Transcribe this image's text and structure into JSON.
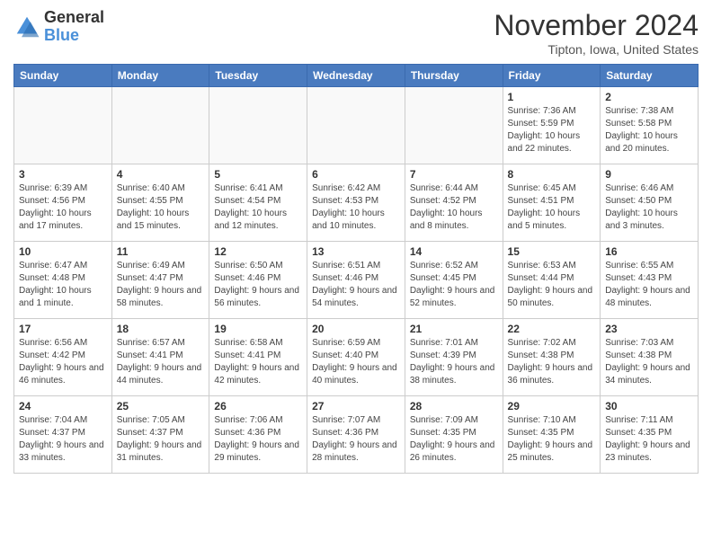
{
  "header": {
    "logo_general": "General",
    "logo_blue": "Blue",
    "month_title": "November 2024",
    "location": "Tipton, Iowa, United States"
  },
  "weekdays": [
    "Sunday",
    "Monday",
    "Tuesday",
    "Wednesday",
    "Thursday",
    "Friday",
    "Saturday"
  ],
  "weeks": [
    [
      {
        "day": "",
        "info": ""
      },
      {
        "day": "",
        "info": ""
      },
      {
        "day": "",
        "info": ""
      },
      {
        "day": "",
        "info": ""
      },
      {
        "day": "",
        "info": ""
      },
      {
        "day": "1",
        "info": "Sunrise: 7:36 AM\nSunset: 5:59 PM\nDaylight: 10 hours and 22 minutes."
      },
      {
        "day": "2",
        "info": "Sunrise: 7:38 AM\nSunset: 5:58 PM\nDaylight: 10 hours and 20 minutes."
      }
    ],
    [
      {
        "day": "3",
        "info": "Sunrise: 6:39 AM\nSunset: 4:56 PM\nDaylight: 10 hours and 17 minutes."
      },
      {
        "day": "4",
        "info": "Sunrise: 6:40 AM\nSunset: 4:55 PM\nDaylight: 10 hours and 15 minutes."
      },
      {
        "day": "5",
        "info": "Sunrise: 6:41 AM\nSunset: 4:54 PM\nDaylight: 10 hours and 12 minutes."
      },
      {
        "day": "6",
        "info": "Sunrise: 6:42 AM\nSunset: 4:53 PM\nDaylight: 10 hours and 10 minutes."
      },
      {
        "day": "7",
        "info": "Sunrise: 6:44 AM\nSunset: 4:52 PM\nDaylight: 10 hours and 8 minutes."
      },
      {
        "day": "8",
        "info": "Sunrise: 6:45 AM\nSunset: 4:51 PM\nDaylight: 10 hours and 5 minutes."
      },
      {
        "day": "9",
        "info": "Sunrise: 6:46 AM\nSunset: 4:50 PM\nDaylight: 10 hours and 3 minutes."
      }
    ],
    [
      {
        "day": "10",
        "info": "Sunrise: 6:47 AM\nSunset: 4:48 PM\nDaylight: 10 hours and 1 minute."
      },
      {
        "day": "11",
        "info": "Sunrise: 6:49 AM\nSunset: 4:47 PM\nDaylight: 9 hours and 58 minutes."
      },
      {
        "day": "12",
        "info": "Sunrise: 6:50 AM\nSunset: 4:46 PM\nDaylight: 9 hours and 56 minutes."
      },
      {
        "day": "13",
        "info": "Sunrise: 6:51 AM\nSunset: 4:46 PM\nDaylight: 9 hours and 54 minutes."
      },
      {
        "day": "14",
        "info": "Sunrise: 6:52 AM\nSunset: 4:45 PM\nDaylight: 9 hours and 52 minutes."
      },
      {
        "day": "15",
        "info": "Sunrise: 6:53 AM\nSunset: 4:44 PM\nDaylight: 9 hours and 50 minutes."
      },
      {
        "day": "16",
        "info": "Sunrise: 6:55 AM\nSunset: 4:43 PM\nDaylight: 9 hours and 48 minutes."
      }
    ],
    [
      {
        "day": "17",
        "info": "Sunrise: 6:56 AM\nSunset: 4:42 PM\nDaylight: 9 hours and 46 minutes."
      },
      {
        "day": "18",
        "info": "Sunrise: 6:57 AM\nSunset: 4:41 PM\nDaylight: 9 hours and 44 minutes."
      },
      {
        "day": "19",
        "info": "Sunrise: 6:58 AM\nSunset: 4:41 PM\nDaylight: 9 hours and 42 minutes."
      },
      {
        "day": "20",
        "info": "Sunrise: 6:59 AM\nSunset: 4:40 PM\nDaylight: 9 hours and 40 minutes."
      },
      {
        "day": "21",
        "info": "Sunrise: 7:01 AM\nSunset: 4:39 PM\nDaylight: 9 hours and 38 minutes."
      },
      {
        "day": "22",
        "info": "Sunrise: 7:02 AM\nSunset: 4:38 PM\nDaylight: 9 hours and 36 minutes."
      },
      {
        "day": "23",
        "info": "Sunrise: 7:03 AM\nSunset: 4:38 PM\nDaylight: 9 hours and 34 minutes."
      }
    ],
    [
      {
        "day": "24",
        "info": "Sunrise: 7:04 AM\nSunset: 4:37 PM\nDaylight: 9 hours and 33 minutes."
      },
      {
        "day": "25",
        "info": "Sunrise: 7:05 AM\nSunset: 4:37 PM\nDaylight: 9 hours and 31 minutes."
      },
      {
        "day": "26",
        "info": "Sunrise: 7:06 AM\nSunset: 4:36 PM\nDaylight: 9 hours and 29 minutes."
      },
      {
        "day": "27",
        "info": "Sunrise: 7:07 AM\nSunset: 4:36 PM\nDaylight: 9 hours and 28 minutes."
      },
      {
        "day": "28",
        "info": "Sunrise: 7:09 AM\nSunset: 4:35 PM\nDaylight: 9 hours and 26 minutes."
      },
      {
        "day": "29",
        "info": "Sunrise: 7:10 AM\nSunset: 4:35 PM\nDaylight: 9 hours and 25 minutes."
      },
      {
        "day": "30",
        "info": "Sunrise: 7:11 AM\nSunset: 4:35 PM\nDaylight: 9 hours and 23 minutes."
      }
    ]
  ]
}
